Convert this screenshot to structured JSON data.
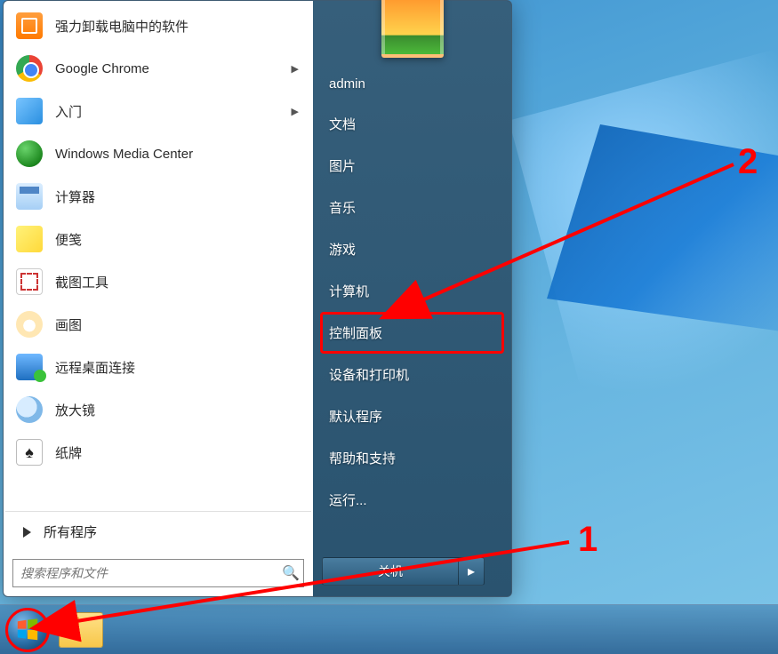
{
  "programs": [
    {
      "key": "uninstall",
      "label": "强力卸载电脑中的软件",
      "submenu": false
    },
    {
      "key": "chrome",
      "label": "Google Chrome",
      "submenu": true
    },
    {
      "key": "welcome",
      "label": "入门",
      "submenu": true
    },
    {
      "key": "wmc",
      "label": "Windows Media Center",
      "submenu": false
    },
    {
      "key": "calc",
      "label": "计算器",
      "submenu": false
    },
    {
      "key": "notes",
      "label": "便笺",
      "submenu": false
    },
    {
      "key": "snip",
      "label": "截图工具",
      "submenu": false
    },
    {
      "key": "paint",
      "label": "画图",
      "submenu": false
    },
    {
      "key": "rdp",
      "label": "远程桌面连接",
      "submenu": false
    },
    {
      "key": "magnify",
      "label": "放大镜",
      "submenu": false
    },
    {
      "key": "solitaire",
      "label": "纸牌",
      "submenu": false
    }
  ],
  "all_programs_label": "所有程序",
  "search_placeholder": "搜索程序和文件",
  "right_items": [
    {
      "key": "user",
      "label": "admin"
    },
    {
      "key": "docs",
      "label": "文档"
    },
    {
      "key": "pics",
      "label": "图片"
    },
    {
      "key": "music",
      "label": "音乐"
    },
    {
      "key": "games",
      "label": "游戏"
    },
    {
      "key": "computer",
      "label": "计算机"
    },
    {
      "key": "cpl",
      "label": "控制面板"
    },
    {
      "key": "devprint",
      "label": "设备和打印机"
    },
    {
      "key": "defprog",
      "label": "默认程序"
    },
    {
      "key": "help",
      "label": "帮助和支持"
    },
    {
      "key": "run",
      "label": "运行..."
    }
  ],
  "shutdown_label": "关机",
  "annotations": {
    "step1": "1",
    "step2": "2"
  }
}
